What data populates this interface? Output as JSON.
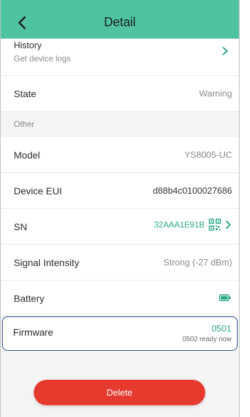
{
  "header": {
    "title": "Detail",
    "back_icon": "chevron-left-icon",
    "background": "#4fc3a1"
  },
  "history": {
    "label": "History",
    "sublabel": "Get device logs",
    "chevron_icon": "chevron-right-icon"
  },
  "state": {
    "label": "State",
    "value": "Warning"
  },
  "section_other": {
    "label": "Other"
  },
  "model": {
    "label": "Model",
    "value": "YS8005-UC"
  },
  "device_eui": {
    "label": "Device EUI",
    "value": "d88b4c0100027686"
  },
  "sn": {
    "label": "SN",
    "value": "32AAA1E91B",
    "qr_icon": "qr-code-icon",
    "chevron_icon": "chevron-right-icon"
  },
  "signal": {
    "label": "Signal Intensity",
    "value": "Strong (-27 dBm)"
  },
  "battery": {
    "label": "Battery",
    "icon": "battery-full-icon",
    "color": "#2aa886"
  },
  "firmware": {
    "label": "Firmware",
    "version": "0501",
    "update_note": "0502 ready now"
  },
  "delete_button": {
    "label": "Delete",
    "color": "#e53a2d"
  }
}
